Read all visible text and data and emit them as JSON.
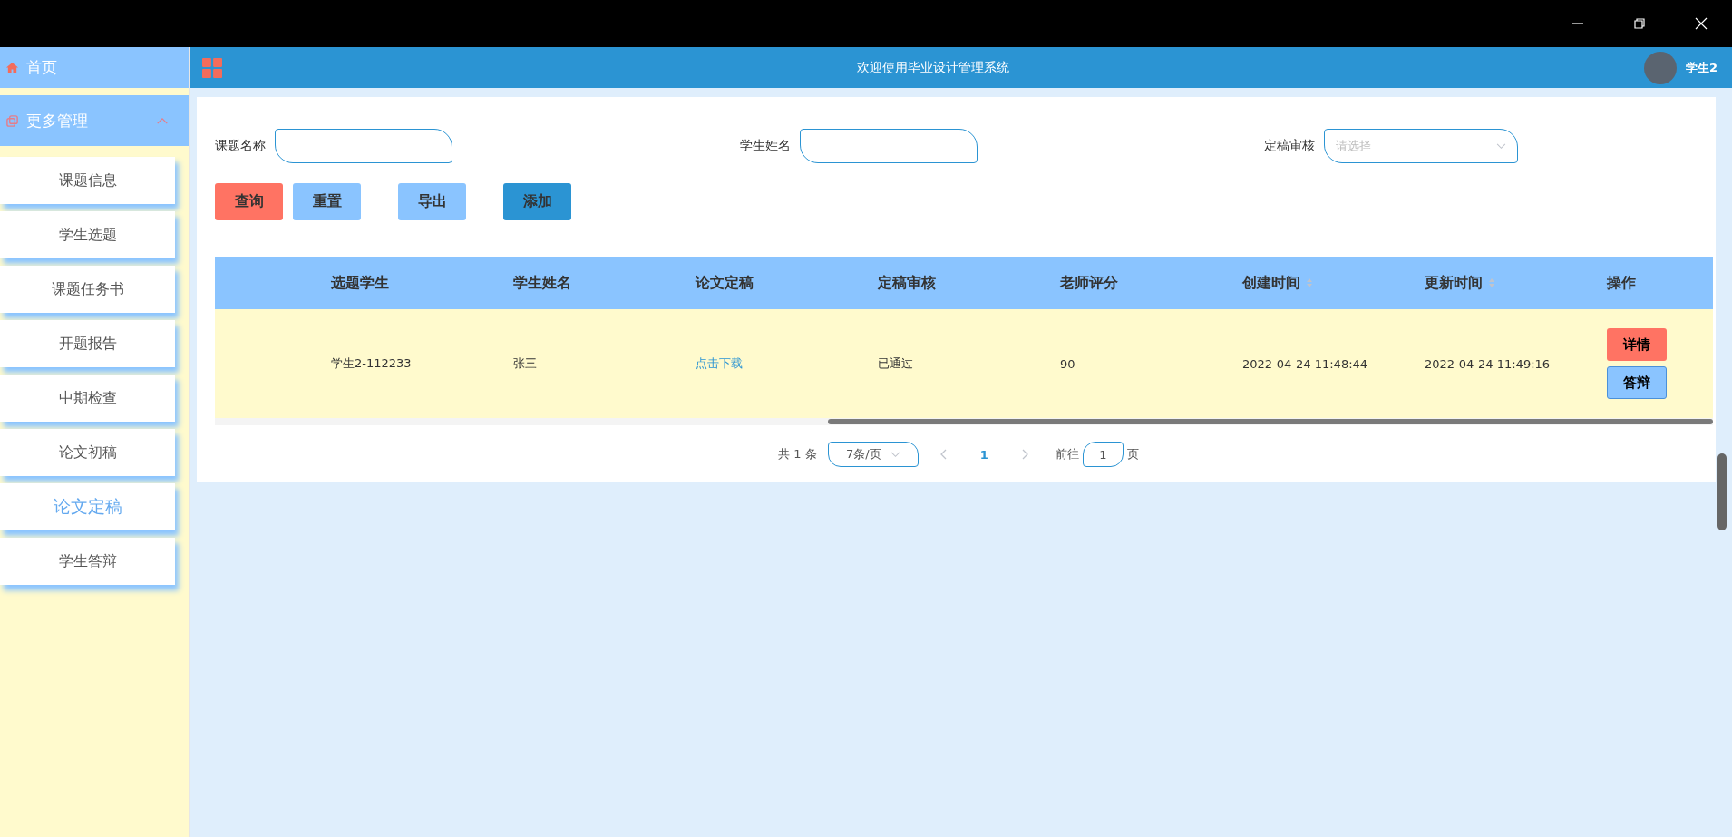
{
  "header": {
    "title": "欢迎使用毕业设计管理系统",
    "user": "学生2"
  },
  "sidebar": {
    "home": "首页",
    "group": {
      "label": "更多管理",
      "expanded": true
    },
    "items": [
      {
        "label": "课题信息",
        "selected": false
      },
      {
        "label": "学生选题",
        "selected": false
      },
      {
        "label": "课题任务书",
        "selected": false
      },
      {
        "label": "开题报告",
        "selected": false
      },
      {
        "label": "中期检查",
        "selected": false
      },
      {
        "label": "论文初稿",
        "selected": false
      },
      {
        "label": "论文定稿",
        "selected": true
      },
      {
        "label": "学生答辩",
        "selected": false
      }
    ]
  },
  "search": {
    "fields": [
      {
        "label": "课题名称",
        "kind": "input"
      },
      {
        "label": "学生姓名",
        "kind": "input"
      },
      {
        "label": "定稿审核",
        "kind": "select",
        "placeholder": "请选择"
      }
    ],
    "buttons": [
      {
        "label": "查询",
        "kind": "danger"
      },
      {
        "label": "重置",
        "kind": "light"
      },
      {
        "label": "导出",
        "kind": "light"
      },
      {
        "label": "添加",
        "kind": "primary"
      }
    ]
  },
  "table": {
    "columns": [
      {
        "label": "选题学生",
        "sortable": false
      },
      {
        "label": "学生姓名",
        "sortable": false
      },
      {
        "label": "论文定稿",
        "sortable": false
      },
      {
        "label": "定稿审核",
        "sortable": false
      },
      {
        "label": "老师评分",
        "sortable": false
      },
      {
        "label": "创建时间",
        "sortable": true
      },
      {
        "label": "更新时间",
        "sortable": true
      },
      {
        "label": "操作",
        "sortable": false
      }
    ],
    "rows": [
      {
        "cells": [
          "学生2-112233",
          "张三",
          "点击下载",
          "已通过",
          "90",
          "2022-04-24 11:48:44",
          "2022-04-24 11:49:16"
        ],
        "actions": [
          {
            "label": "详情",
            "kind": "danger"
          },
          {
            "label": "答辩",
            "kind": "light"
          }
        ]
      }
    ]
  },
  "pagination": {
    "total": "共 1 条",
    "page_size": "7条/页",
    "pages": [
      {
        "label": "1",
        "selected": true
      }
    ],
    "goto_label": "前往",
    "goto_value": "1",
    "goto_suffix": "页"
  }
}
